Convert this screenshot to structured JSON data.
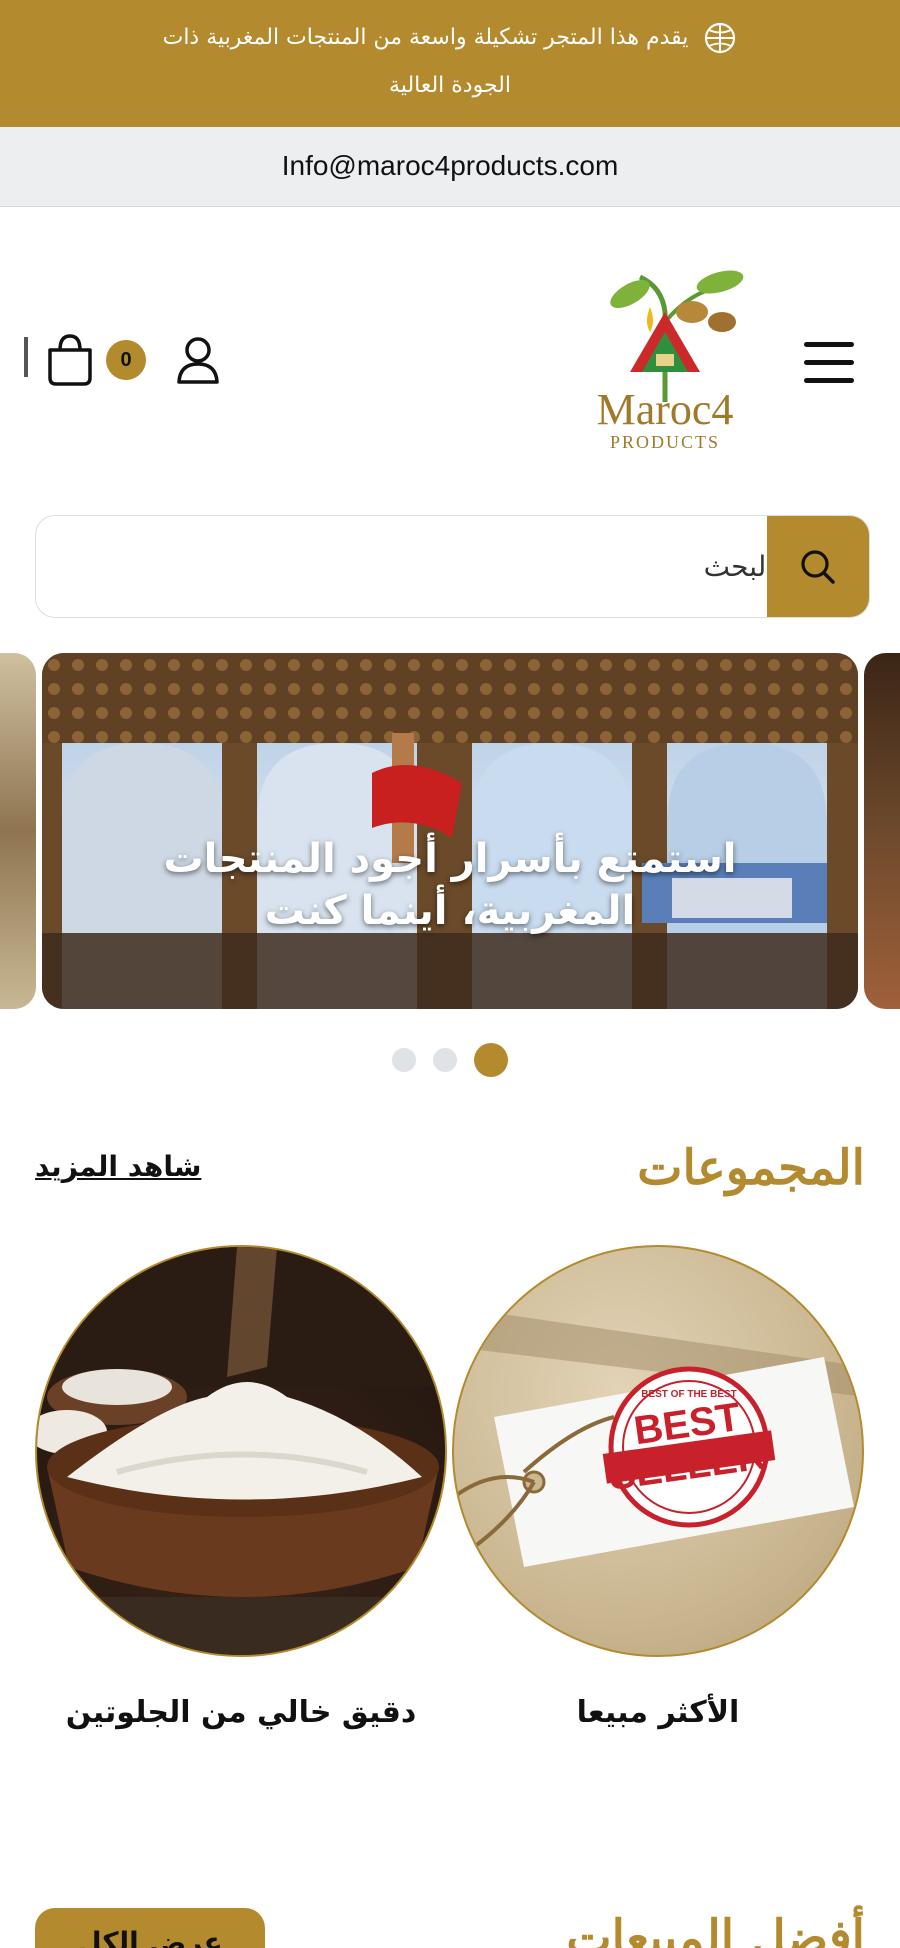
{
  "announcement": {
    "text": "يقدم هذا المتجر تشكيلة واسعة من المنتجات المغربية ذات الجودة العالية",
    "icon": "globe-icon"
  },
  "info_bar": {
    "email": "Info@maroc4products.com"
  },
  "header": {
    "logo": {
      "name": "Maroc4",
      "subtitle": "PRODUCTS"
    },
    "cart_count": "0",
    "icons": [
      "menu-icon",
      "account-icon",
      "cart-icon"
    ]
  },
  "search": {
    "placeholder": "البحث",
    "icon": "search-icon"
  },
  "slider": {
    "caption": "استمتع بأسرار أجود المنتجات المغربية، أينما كنت",
    "slide_count": 3,
    "active_index": 2
  },
  "collections": {
    "title": "المجموعات",
    "see_more": "شاهد المزيد",
    "items": [
      {
        "label": "الأكثر مبيعا",
        "image": "best-seller-tag"
      },
      {
        "label": "دقيق خالي من الجلوتين",
        "image": "flour-bowl"
      }
    ],
    "best_seller_stamp": {
      "top": "BEST OF THE BEST",
      "line1": "BEST",
      "line2": "SELLER"
    }
  },
  "next_section": {
    "title": "أفضل المبيعات",
    "button": "عرض الكل"
  },
  "colors": {
    "accent": "#b48a2e",
    "info_bar_bg": "#eceef0",
    "text": "#111111"
  }
}
